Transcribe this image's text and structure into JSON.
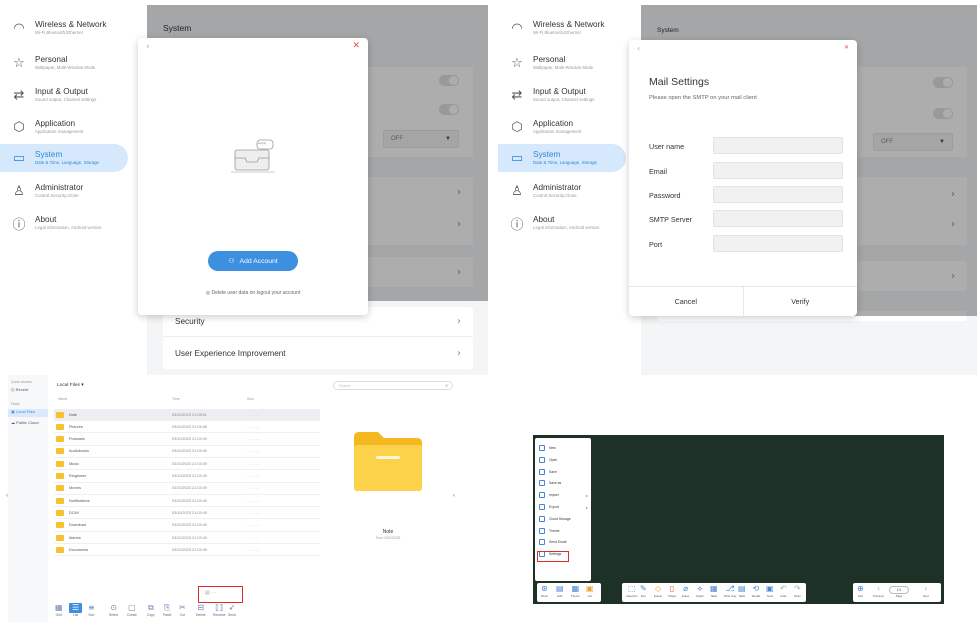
{
  "sidebar": {
    "items": [
      {
        "icon": "wifi-icon",
        "title": "Wireless & Network",
        "subtitle": "Wi-Fi,Bluetooth,Ethernet"
      },
      {
        "icon": "star-icon",
        "title": "Personal",
        "subtitle": "Wallpaper, Multi-Window Mode"
      },
      {
        "icon": "swap-arrows-icon",
        "title": "Input & Output",
        "subtitle": "Sound output, Channel settings"
      },
      {
        "icon": "cube-icon",
        "title": "Application",
        "subtitle": "Application management"
      },
      {
        "icon": "monitor-icon",
        "title": "System",
        "subtitle": "Date & Time, Language, Storage"
      },
      {
        "icon": "person-icon",
        "title": "Administrator",
        "subtitle": "Control,Security,Clone"
      },
      {
        "icon": "info-icon",
        "title": "About",
        "subtitle": "Legal information, Android version"
      }
    ]
  },
  "settings": {
    "header": "System",
    "select_value": "OFF",
    "rows_bottom": [
      "Security",
      "User Experience Improvement"
    ]
  },
  "account_dialog": {
    "empty_badge": "empty",
    "add_button": "Add Account",
    "delete_check": "Delete user data on logout your account"
  },
  "mail_dialog": {
    "title": "Mail Settings",
    "subtitle": "Please open the SMTP on your mail client",
    "fields": [
      "User name",
      "Email",
      "Password",
      "SMTP Server",
      "Port"
    ],
    "cancel": "Cancel",
    "verify": "Verify"
  },
  "file_manager": {
    "side_heading1": "Quick access",
    "recent": "Recent",
    "side_heading2": "Disks",
    "local_files": "Local Files",
    "public_cloud": "Public Cloud",
    "breadcrumb": "Local Files ▾",
    "search_placeholder": "Search",
    "columns": [
      "Name",
      "Time",
      "Size"
    ],
    "rows": [
      {
        "name": "Note",
        "time": "03/10/2023 21:08:51",
        "size": "- - - - - -"
      },
      {
        "name": "Pictures",
        "time": "03/10/2023 21:04:08",
        "size": "- - - - - -"
      },
      {
        "name": "Podcasts",
        "time": "03/10/2023 21:03:49",
        "size": "- - - - - -"
      },
      {
        "name": "Audiobooks",
        "time": "03/10/2023 21:03:49",
        "size": "- - - - - -"
      },
      {
        "name": "Music",
        "time": "03/10/2023 21:03:49",
        "size": "- - - - - -"
      },
      {
        "name": "Ringtones",
        "time": "03/10/2023 21:03:49",
        "size": "- - - - - -"
      },
      {
        "name": "Movies",
        "time": "03/10/2023 21:03:49",
        "size": "- - - - - -"
      },
      {
        "name": "Notifications",
        "time": "03/10/2023 21:03:49",
        "size": "- - - - - -"
      },
      {
        "name": "DCIM",
        "time": "03/10/2023 21:03:49",
        "size": "- - - - - -"
      },
      {
        "name": "Download",
        "time": "03/10/2023 21:03:49",
        "size": "- - - - - -"
      },
      {
        "name": "Alarms",
        "time": "03/10/2023 21:03:49",
        "size": "- - - - - -"
      },
      {
        "name": "Documents",
        "time": "03/10/2023 21:03:49",
        "size": "- - - - - -"
      }
    ],
    "preview_name": "Note",
    "preview_time": "Time: 03/10/2023",
    "toolbar": [
      "Grid",
      "List",
      "Sort",
      "Select",
      "Create",
      "Copy",
      "Paste",
      "Cut",
      "Delete",
      "Rename",
      "Send"
    ]
  },
  "whiteboard": {
    "menu": [
      "New",
      "Open",
      "Save",
      "Save as",
      "Import",
      "Export",
      "Cloud Storage",
      "Theme",
      "Send Email",
      "Settings"
    ],
    "left_tools": [
      "Menu",
      "Edit",
      "Theme",
      "Cut"
    ],
    "mid_tools": [
      "Selection",
      "Pen",
      "Eraser",
      "Shape",
      "Erase",
      "Graph",
      "Table",
      "Mind map",
      "Table",
      "Recall",
      "Tools",
      "Undo",
      "Redo"
    ],
    "right_tools": [
      "Add",
      "Previous",
      "Page",
      "Next"
    ],
    "page_indicator": "1/1"
  }
}
